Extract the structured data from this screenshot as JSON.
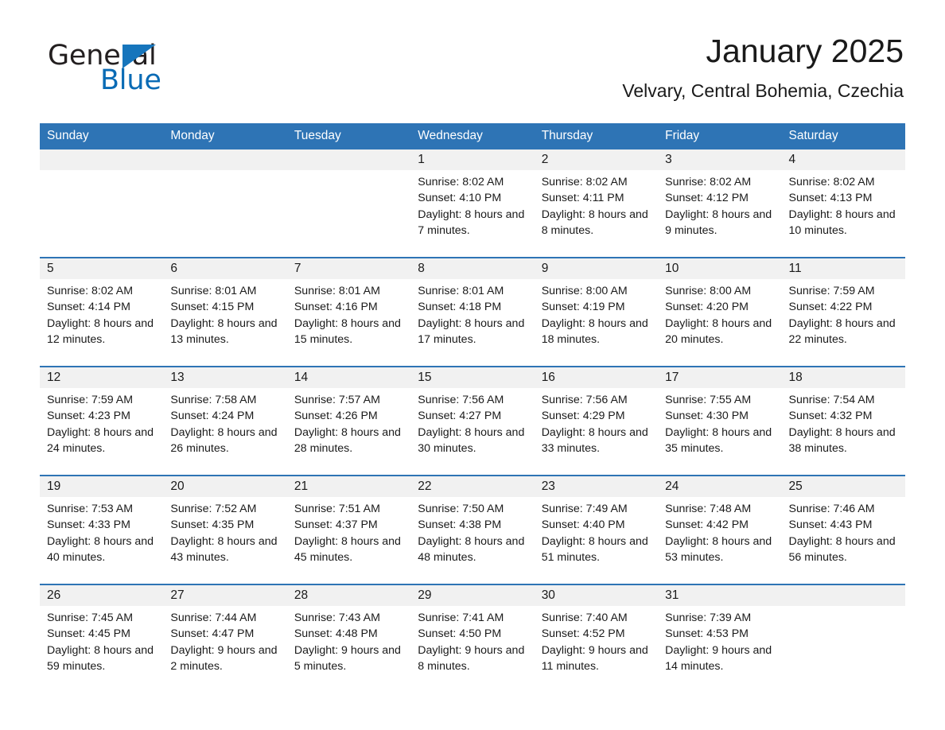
{
  "brand": {
    "name_part1": "General",
    "name_part2": "Blue",
    "triangle_color": "#1675bc",
    "text_color": "#231f20",
    "blue_color": "#0a6bb5"
  },
  "header": {
    "title": "January 2025",
    "subtitle": "Velvary, Central Bohemia, Czechia"
  },
  "theme": {
    "header_bg": "#2e74b5",
    "header_text": "#ffffff",
    "daynum_bg": "#f1f1f1",
    "cell_bg": "#ffffff",
    "divider": "#2e74b5"
  },
  "calendar": {
    "weekday_headers": [
      "Sunday",
      "Monday",
      "Tuesday",
      "Wednesday",
      "Thursday",
      "Friday",
      "Saturday"
    ],
    "weeks": [
      [
        {
          "day": "",
          "sunrise": "",
          "sunset": "",
          "daylight": ""
        },
        {
          "day": "",
          "sunrise": "",
          "sunset": "",
          "daylight": ""
        },
        {
          "day": "",
          "sunrise": "",
          "sunset": "",
          "daylight": ""
        },
        {
          "day": "1",
          "sunrise": "Sunrise: 8:02 AM",
          "sunset": "Sunset: 4:10 PM",
          "daylight": "Daylight: 8 hours and 7 minutes."
        },
        {
          "day": "2",
          "sunrise": "Sunrise: 8:02 AM",
          "sunset": "Sunset: 4:11 PM",
          "daylight": "Daylight: 8 hours and 8 minutes."
        },
        {
          "day": "3",
          "sunrise": "Sunrise: 8:02 AM",
          "sunset": "Sunset: 4:12 PM",
          "daylight": "Daylight: 8 hours and 9 minutes."
        },
        {
          "day": "4",
          "sunrise": "Sunrise: 8:02 AM",
          "sunset": "Sunset: 4:13 PM",
          "daylight": "Daylight: 8 hours and 10 minutes."
        }
      ],
      [
        {
          "day": "5",
          "sunrise": "Sunrise: 8:02 AM",
          "sunset": "Sunset: 4:14 PM",
          "daylight": "Daylight: 8 hours and 12 minutes."
        },
        {
          "day": "6",
          "sunrise": "Sunrise: 8:01 AM",
          "sunset": "Sunset: 4:15 PM",
          "daylight": "Daylight: 8 hours and 13 minutes."
        },
        {
          "day": "7",
          "sunrise": "Sunrise: 8:01 AM",
          "sunset": "Sunset: 4:16 PM",
          "daylight": "Daylight: 8 hours and 15 minutes."
        },
        {
          "day": "8",
          "sunrise": "Sunrise: 8:01 AM",
          "sunset": "Sunset: 4:18 PM",
          "daylight": "Daylight: 8 hours and 17 minutes."
        },
        {
          "day": "9",
          "sunrise": "Sunrise: 8:00 AM",
          "sunset": "Sunset: 4:19 PM",
          "daylight": "Daylight: 8 hours and 18 minutes."
        },
        {
          "day": "10",
          "sunrise": "Sunrise: 8:00 AM",
          "sunset": "Sunset: 4:20 PM",
          "daylight": "Daylight: 8 hours and 20 minutes."
        },
        {
          "day": "11",
          "sunrise": "Sunrise: 7:59 AM",
          "sunset": "Sunset: 4:22 PM",
          "daylight": "Daylight: 8 hours and 22 minutes."
        }
      ],
      [
        {
          "day": "12",
          "sunrise": "Sunrise: 7:59 AM",
          "sunset": "Sunset: 4:23 PM",
          "daylight": "Daylight: 8 hours and 24 minutes."
        },
        {
          "day": "13",
          "sunrise": "Sunrise: 7:58 AM",
          "sunset": "Sunset: 4:24 PM",
          "daylight": "Daylight: 8 hours and 26 minutes."
        },
        {
          "day": "14",
          "sunrise": "Sunrise: 7:57 AM",
          "sunset": "Sunset: 4:26 PM",
          "daylight": "Daylight: 8 hours and 28 minutes."
        },
        {
          "day": "15",
          "sunrise": "Sunrise: 7:56 AM",
          "sunset": "Sunset: 4:27 PM",
          "daylight": "Daylight: 8 hours and 30 minutes."
        },
        {
          "day": "16",
          "sunrise": "Sunrise: 7:56 AM",
          "sunset": "Sunset: 4:29 PM",
          "daylight": "Daylight: 8 hours and 33 minutes."
        },
        {
          "day": "17",
          "sunrise": "Sunrise: 7:55 AM",
          "sunset": "Sunset: 4:30 PM",
          "daylight": "Daylight: 8 hours and 35 minutes."
        },
        {
          "day": "18",
          "sunrise": "Sunrise: 7:54 AM",
          "sunset": "Sunset: 4:32 PM",
          "daylight": "Daylight: 8 hours and 38 minutes."
        }
      ],
      [
        {
          "day": "19",
          "sunrise": "Sunrise: 7:53 AM",
          "sunset": "Sunset: 4:33 PM",
          "daylight": "Daylight: 8 hours and 40 minutes."
        },
        {
          "day": "20",
          "sunrise": "Sunrise: 7:52 AM",
          "sunset": "Sunset: 4:35 PM",
          "daylight": "Daylight: 8 hours and 43 minutes."
        },
        {
          "day": "21",
          "sunrise": "Sunrise: 7:51 AM",
          "sunset": "Sunset: 4:37 PM",
          "daylight": "Daylight: 8 hours and 45 minutes."
        },
        {
          "day": "22",
          "sunrise": "Sunrise: 7:50 AM",
          "sunset": "Sunset: 4:38 PM",
          "daylight": "Daylight: 8 hours and 48 minutes."
        },
        {
          "day": "23",
          "sunrise": "Sunrise: 7:49 AM",
          "sunset": "Sunset: 4:40 PM",
          "daylight": "Daylight: 8 hours and 51 minutes."
        },
        {
          "day": "24",
          "sunrise": "Sunrise: 7:48 AM",
          "sunset": "Sunset: 4:42 PM",
          "daylight": "Daylight: 8 hours and 53 minutes."
        },
        {
          "day": "25",
          "sunrise": "Sunrise: 7:46 AM",
          "sunset": "Sunset: 4:43 PM",
          "daylight": "Daylight: 8 hours and 56 minutes."
        }
      ],
      [
        {
          "day": "26",
          "sunrise": "Sunrise: 7:45 AM",
          "sunset": "Sunset: 4:45 PM",
          "daylight": "Daylight: 8 hours and 59 minutes."
        },
        {
          "day": "27",
          "sunrise": "Sunrise: 7:44 AM",
          "sunset": "Sunset: 4:47 PM",
          "daylight": "Daylight: 9 hours and 2 minutes."
        },
        {
          "day": "28",
          "sunrise": "Sunrise: 7:43 AM",
          "sunset": "Sunset: 4:48 PM",
          "daylight": "Daylight: 9 hours and 5 minutes."
        },
        {
          "day": "29",
          "sunrise": "Sunrise: 7:41 AM",
          "sunset": "Sunset: 4:50 PM",
          "daylight": "Daylight: 9 hours and 8 minutes."
        },
        {
          "day": "30",
          "sunrise": "Sunrise: 7:40 AM",
          "sunset": "Sunset: 4:52 PM",
          "daylight": "Daylight: 9 hours and 11 minutes."
        },
        {
          "day": "31",
          "sunrise": "Sunrise: 7:39 AM",
          "sunset": "Sunset: 4:53 PM",
          "daylight": "Daylight: 9 hours and 14 minutes."
        },
        {
          "day": "",
          "sunrise": "",
          "sunset": "",
          "daylight": ""
        }
      ]
    ]
  }
}
